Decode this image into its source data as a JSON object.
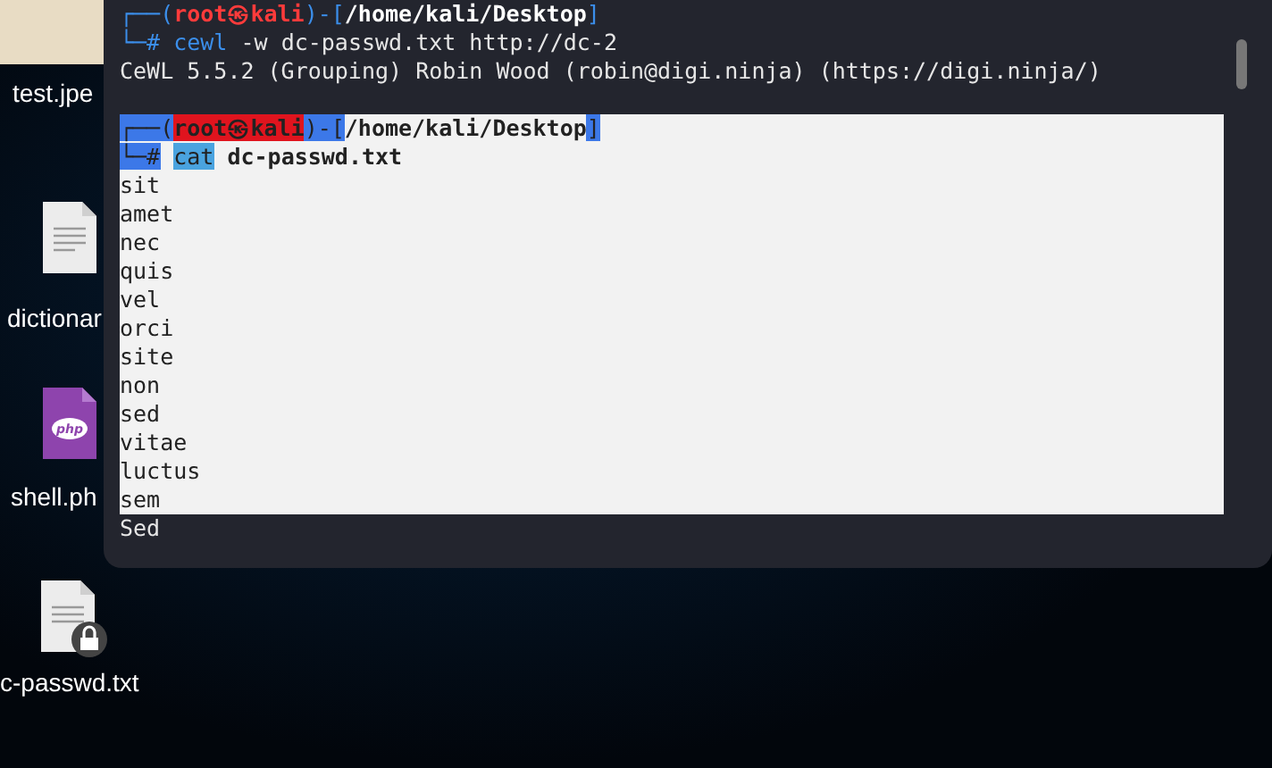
{
  "desktop": {
    "icons": [
      {
        "kind": "photo",
        "label": "test.jpe"
      },
      {
        "kind": "document",
        "label": "dictionar"
      },
      {
        "kind": "php",
        "label": "shell.ph"
      },
      {
        "kind": "locked",
        "label": "c-passwd.txt"
      }
    ]
  },
  "terminal": {
    "lines": [
      {
        "kind": "prompt",
        "open": "┌──(",
        "user": "root㉿kali",
        "sep": ")-[",
        "path": "/home/kali/Desktop",
        "close": "]",
        "selected": false
      },
      {
        "kind": "command",
        "mark": "└─#",
        "command": "cewl",
        "args": "-w dc-passwd.txt http://dc-2",
        "selected": false
      },
      {
        "kind": "output",
        "text": "CeWL 5.5.2 (Grouping) Robin Wood (robin@digi.ninja) (https://digi.ninja/)",
        "selected": false
      },
      {
        "kind": "blank",
        "selected": false
      },
      {
        "kind": "prompt",
        "open": "┌──(",
        "user": "root㉿kali",
        "sep": ")-[",
        "path": "/home/kali/Desktop",
        "close": "]",
        "selected": true
      },
      {
        "kind": "command",
        "mark": "└─#",
        "command": "cat",
        "args": "dc-passwd.txt",
        "selected": true
      },
      {
        "kind": "output",
        "text": "sit",
        "selected": true
      },
      {
        "kind": "output",
        "text": "amet",
        "selected": true
      },
      {
        "kind": "output",
        "text": "nec",
        "selected": true
      },
      {
        "kind": "output",
        "text": "quis",
        "selected": true
      },
      {
        "kind": "output",
        "text": "vel",
        "selected": true
      },
      {
        "kind": "output",
        "text": "orci",
        "selected": true
      },
      {
        "kind": "output",
        "text": "site",
        "selected": true
      },
      {
        "kind": "output",
        "text": "non",
        "selected": true
      },
      {
        "kind": "output",
        "text": "sed",
        "selected": true
      },
      {
        "kind": "output",
        "text": "vitae",
        "selected": true
      },
      {
        "kind": "output",
        "text": "luctus",
        "selected": true
      },
      {
        "kind": "output",
        "text": "sem",
        "selected": true
      },
      {
        "kind": "output",
        "text": "Sed",
        "selected": false
      }
    ]
  }
}
